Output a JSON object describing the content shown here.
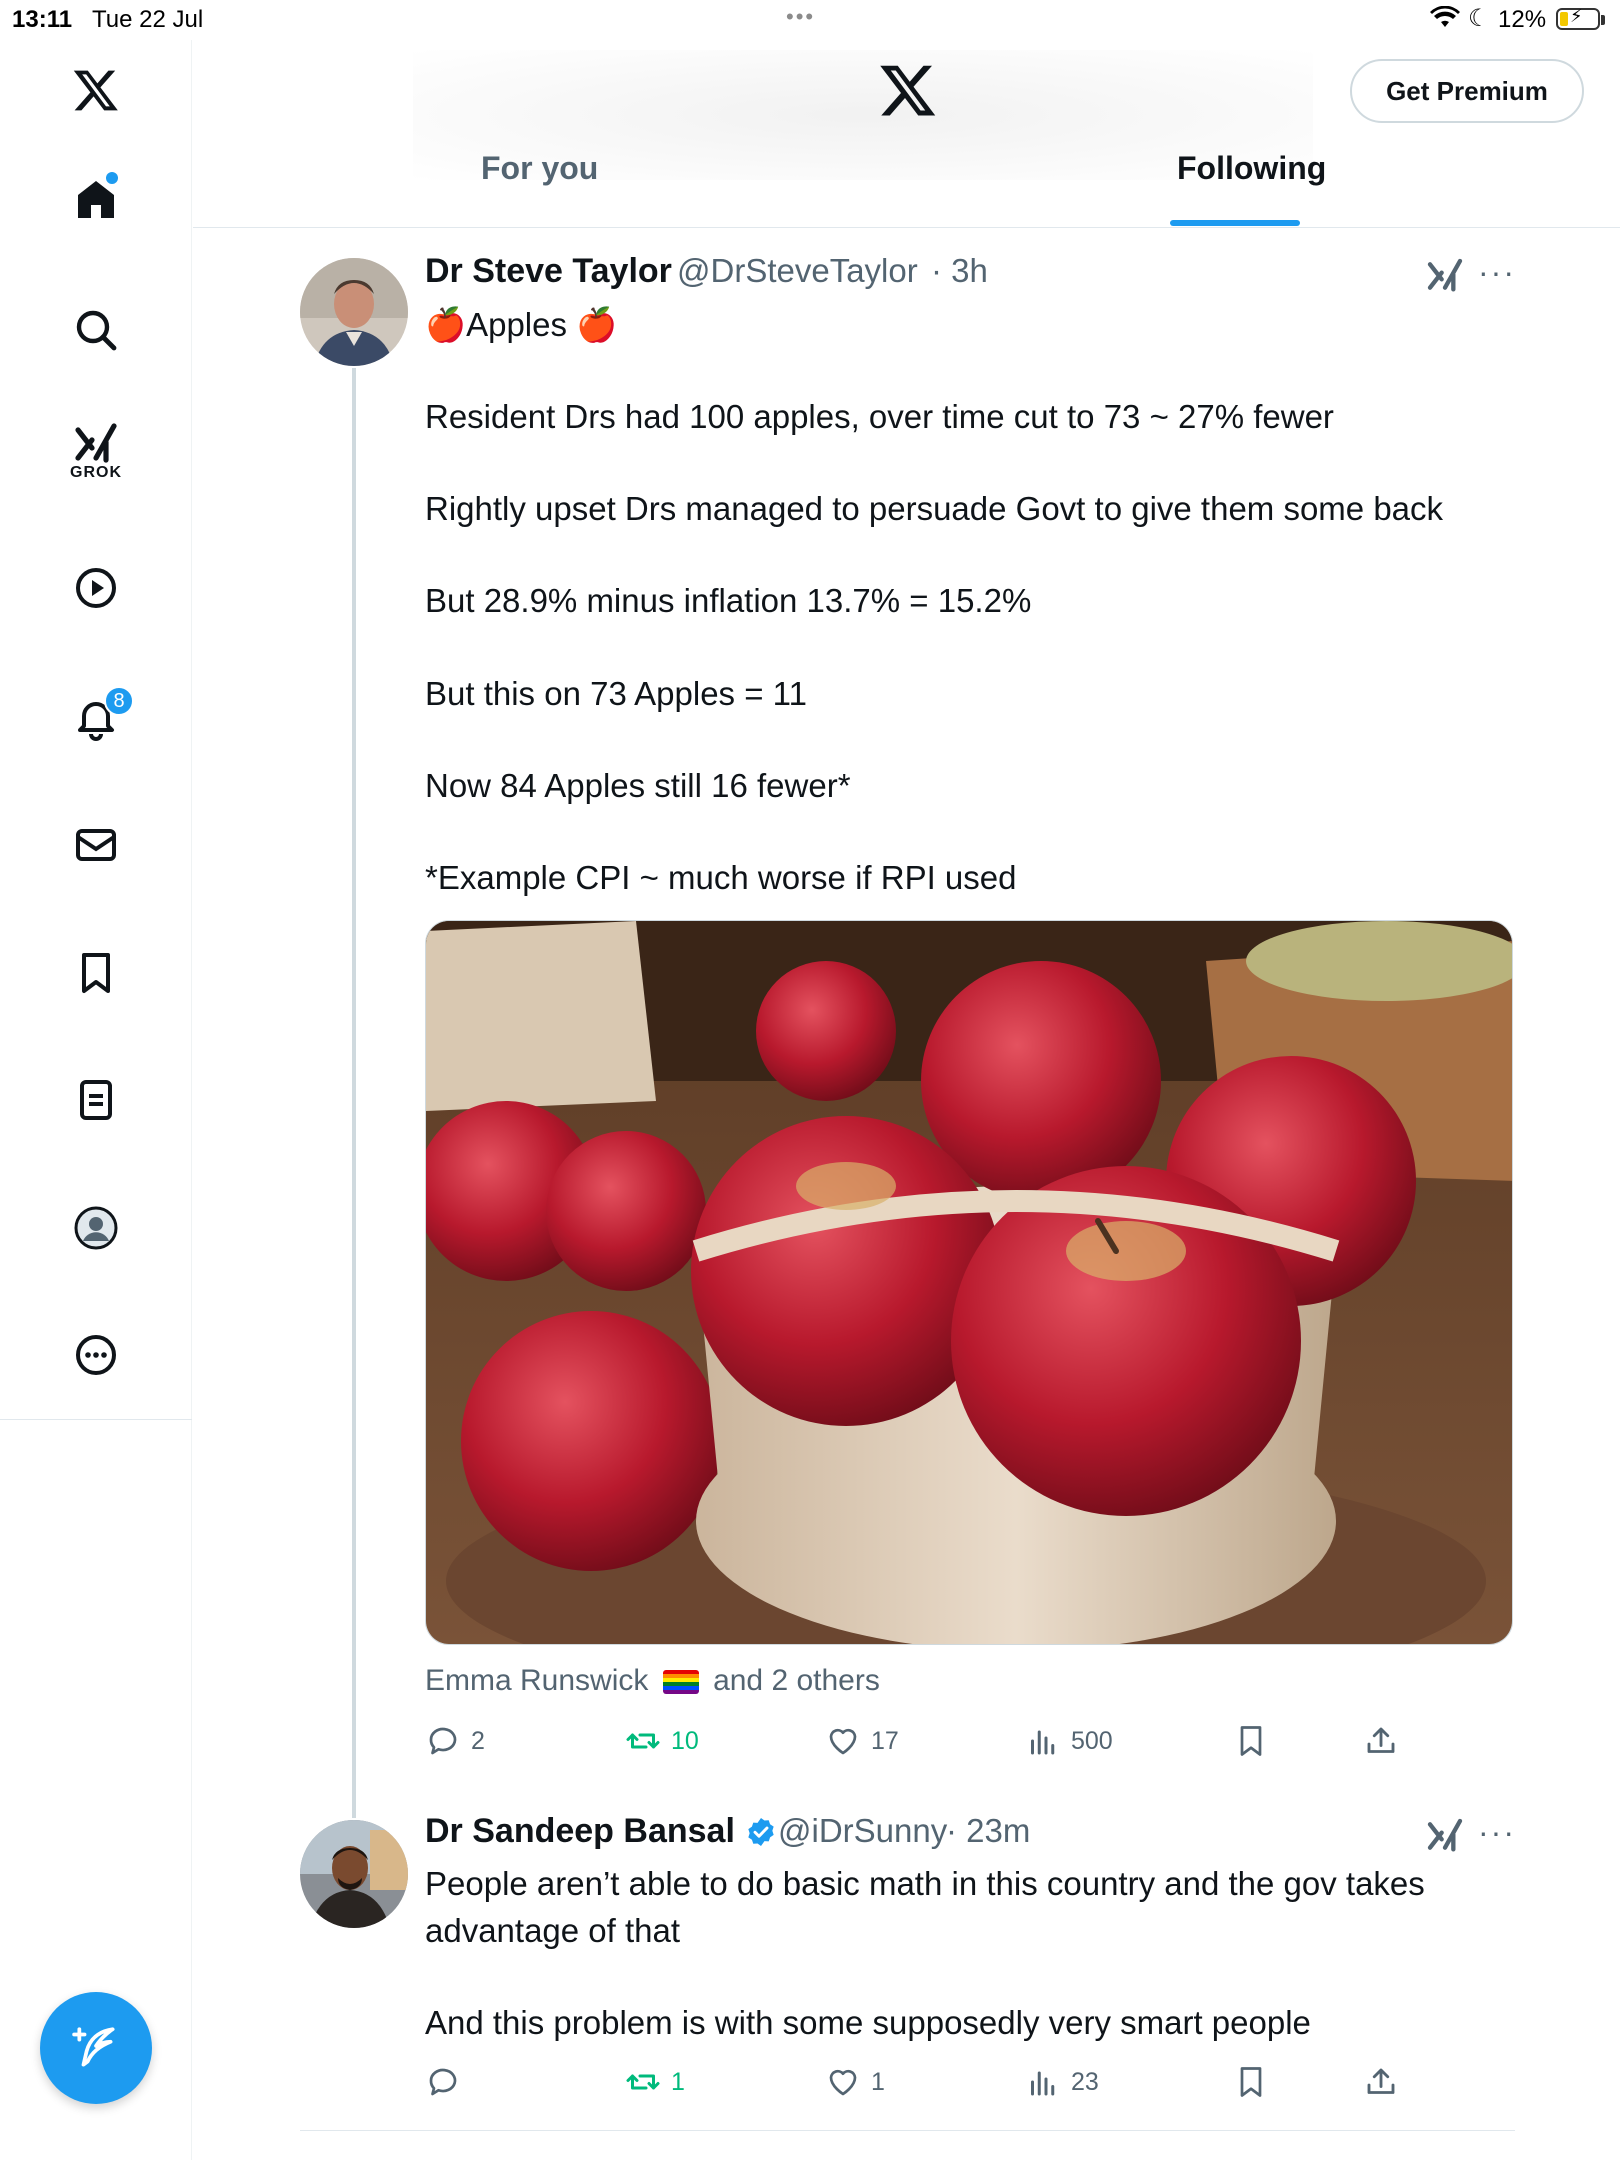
{
  "status_bar": {
    "time": "13:11",
    "date": "Tue 22 Jul",
    "dots": "•••",
    "battery": "12%"
  },
  "sidebar": {
    "grok_label": "GROK",
    "notification_count": "8",
    "icons": [
      "x-logo-icon",
      "home-icon",
      "search-icon",
      "grok-icon",
      "video-icon",
      "bell-icon",
      "mail-icon",
      "bookmark-icon",
      "list-icon",
      "profile-icon",
      "more-icon"
    ]
  },
  "header": {
    "premium_label": "Get Premium",
    "tabs": [
      "For you",
      "Following"
    ],
    "active_tab": "Following"
  },
  "tweets": [
    {
      "name": "Dr Steve Taylor",
      "handle": "@DrSteveTaylor",
      "time": "· 3h",
      "lines": [
        "Apples",
        "Resident Drs had 100 apples, over time cut to 73 ~ 27% fewer",
        "Rightly upset Drs managed to persuade Govt to give them some back",
        "But 28.9% minus inflation 13.7% = 15.2%",
        "But this on 73 Apples = 11",
        "Now 84 Apples still 16 fewer*",
        "*Example CPI ~ much worse if RPI used"
      ],
      "liked_by": "Emma Runswick",
      "liked_by_rest": "and 2 others",
      "replies": "2",
      "reposts": "10",
      "likes": "17",
      "views": "500"
    },
    {
      "name": "Dr Sandeep Bansal",
      "handle": "@iDrSunny",
      "time": "· 23m",
      "lines": [
        "People aren’t able to do basic math in this country and the gov takes",
        "advantage of that",
        "And this problem is with some supposedly very smart people"
      ],
      "replies": "",
      "reposts": "1",
      "likes": "1",
      "views": "23"
    }
  ],
  "colors": {
    "accent": "#1d9bf0",
    "repost_green": "#00ba7c",
    "secondary_text": "#536471"
  }
}
